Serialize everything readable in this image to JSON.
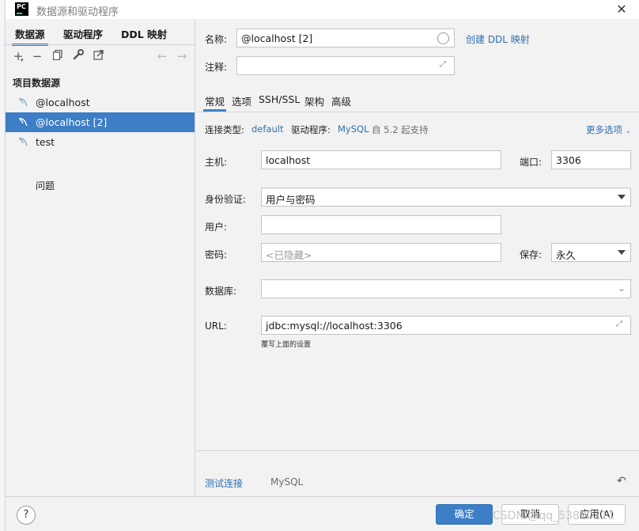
{
  "window": {
    "title": "数据源和驱动程序",
    "app_icon_text": "PC"
  },
  "left": {
    "tabs": [
      "数据源",
      "驱动程序",
      "DDL 映射"
    ],
    "section_title": "项目数据源",
    "datasources": [
      "@localhost",
      "@localhost [2]",
      "test"
    ],
    "problems": "问题",
    "toolbar_icons": [
      "add-icon",
      "remove-icon",
      "copy-icon",
      "wrench-icon",
      "export-icon",
      "back-icon",
      "forward-icon"
    ]
  },
  "form": {
    "name_label": "名称:",
    "name_value": "@localhost [2]",
    "create_ddl_link": "创建 DDL 映射",
    "comment_label": "注释:",
    "comment_value": "",
    "subtabs": [
      "常规",
      "选项",
      "SSH/SSL",
      "架构",
      "高级"
    ],
    "conn_type_label": "连接类型:",
    "conn_type_value": "default",
    "driver_label": "驱动程序:",
    "driver_value": "MySQL",
    "driver_note": "自 5.2 起支持",
    "more_options": "更多选项",
    "host_label": "主机:",
    "host_value": "localhost",
    "port_label": "端口:",
    "port_value": "3306",
    "auth_label": "身份验证:",
    "auth_value": "用户与密码",
    "user_label": "用户:",
    "user_value": "",
    "password_label": "密码:",
    "password_placeholder": "<已隐藏>",
    "save_label": "保存:",
    "save_value": "永久",
    "database_label": "数据库:",
    "database_value": "",
    "url_label": "URL:",
    "url_value": "jdbc:mysql://localhost:3306",
    "url_hint": "覆写上面的设置",
    "test_connection": "测试连接",
    "test_driver": "MySQL"
  },
  "footer": {
    "help": "?",
    "ok": "确定",
    "cancel": "取消",
    "apply": "应用(A)",
    "watermark": "CSDN @qq_53820211"
  },
  "colors": {
    "accent": "#3d7ec6",
    "link": "#2f6fb0",
    "panel": "#f2f2f2"
  }
}
